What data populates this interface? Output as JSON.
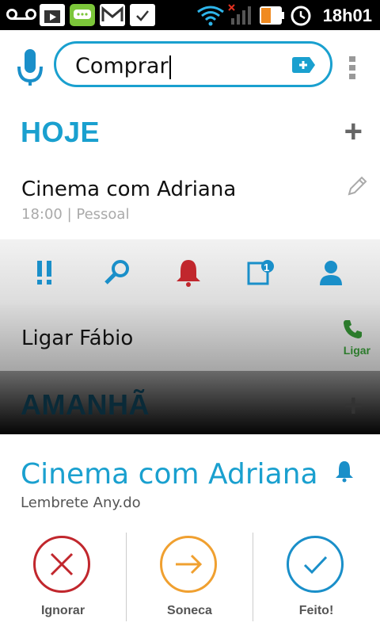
{
  "statusbar": {
    "time": "18h01",
    "icons": [
      "voicemail-icon",
      "market-icon",
      "talk-icon",
      "gmail-icon",
      "task-check-icon",
      "wifi-icon",
      "signal-icon",
      "battery-icon",
      "alarm-icon"
    ]
  },
  "search": {
    "value": "Comprar",
    "icons": [
      "microphone-icon",
      "add-tag-icon",
      "overflow-menu-icon"
    ]
  },
  "today": {
    "title": "HOJE",
    "add_symbol": "+",
    "task": {
      "title": "Cinema com Adriana",
      "subtitle": "18:00 | Pessoal"
    },
    "toolbar_icons": [
      "priority-icon",
      "search-icon",
      "bell-icon",
      "note-icon",
      "contact-icon"
    ],
    "note_count": "1",
    "task2": {
      "title": "Ligar Fábio",
      "action_label": "Ligar"
    }
  },
  "tomorrow": {
    "title": "AMANHÃ",
    "add_symbol": "+"
  },
  "reminder": {
    "title": "Cinema com Adriana",
    "subtitle": "Lembrete Any.do",
    "actions": [
      {
        "label": "Ignorar",
        "color": "#c1272d",
        "icon": "close-icon"
      },
      {
        "label": "Soneca",
        "color": "#f0a030",
        "icon": "arrow-right-icon"
      },
      {
        "label": "Feito!",
        "color": "#1a8fc9",
        "icon": "check-icon"
      }
    ]
  },
  "colors": {
    "accent": "#1aa0cf",
    "alert_red": "#c1272d",
    "call_green": "#2c7b2c"
  }
}
